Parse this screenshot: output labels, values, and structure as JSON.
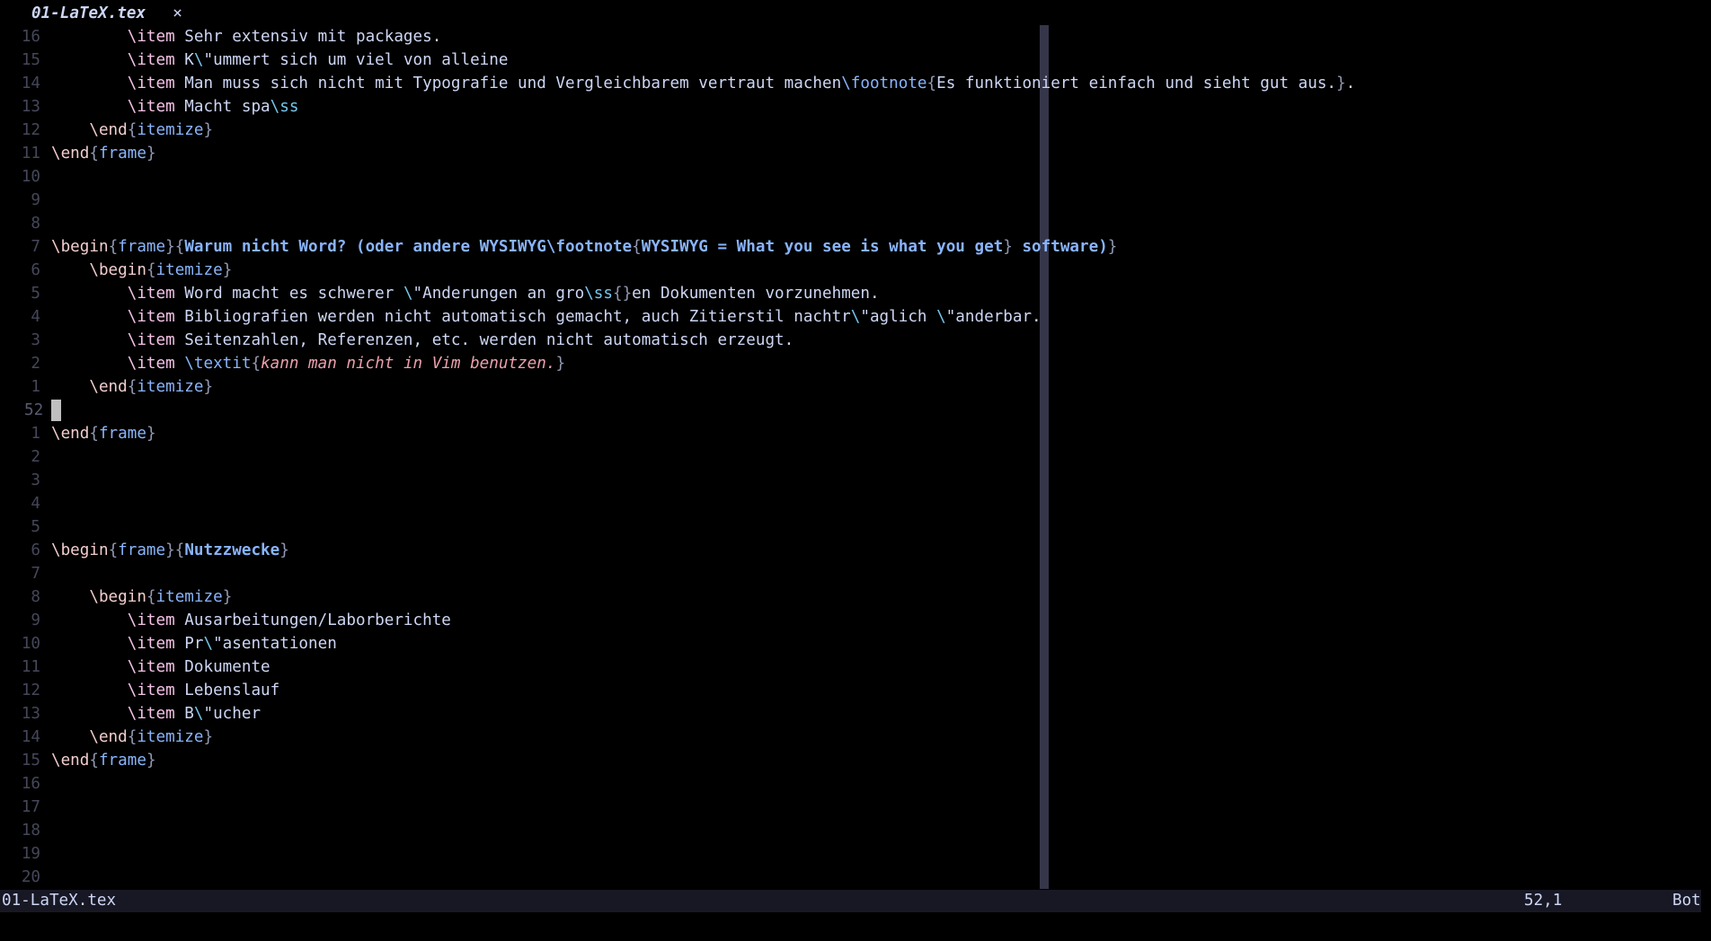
{
  "tab": {
    "title": "01-LaTeX.tex",
    "close_icon": "×"
  },
  "editor": {
    "colorcolumn": 100,
    "lines": [
      {
        "num": "16",
        "segs": [
          {
            "c": "ind",
            "t": "        "
          },
          {
            "c": "cmd",
            "t": "\\item"
          },
          {
            "c": "txt",
            "t": " Sehr extensiv mit packages."
          }
        ]
      },
      {
        "num": "15",
        "segs": [
          {
            "c": "ind",
            "t": "        "
          },
          {
            "c": "cmd",
            "t": "\\item"
          },
          {
            "c": "txt",
            "t": " K"
          },
          {
            "c": "esc",
            "t": "\\"
          },
          {
            "c": "txt",
            "t": "\"ummert sich um viel von alleine"
          }
        ]
      },
      {
        "num": "14",
        "segs": [
          {
            "c": "ind",
            "t": "        "
          },
          {
            "c": "cmd",
            "t": "\\item"
          },
          {
            "c": "txt",
            "t": " Man muss sich nicht mit Typografie und Vergleichbarem vertraut machen"
          },
          {
            "c": "fn",
            "t": "\\footnote"
          },
          {
            "c": "brace",
            "t": "{"
          },
          {
            "c": "txt",
            "t": "Es funktioniert einfach und sieht gut aus."
          },
          {
            "c": "brace",
            "t": "}"
          },
          {
            "c": "txt",
            "t": "."
          }
        ]
      },
      {
        "num": "13",
        "segs": [
          {
            "c": "ind",
            "t": "        "
          },
          {
            "c": "cmd",
            "t": "\\item"
          },
          {
            "c": "txt",
            "t": " Macht spa"
          },
          {
            "c": "esc",
            "t": "\\ss"
          }
        ]
      },
      {
        "num": "12",
        "segs": [
          {
            "c": "ind",
            "t": "    "
          },
          {
            "c": "cmdb",
            "t": "\\end"
          },
          {
            "c": "brace",
            "t": "{"
          },
          {
            "c": "env",
            "t": "itemize"
          },
          {
            "c": "brace",
            "t": "}"
          }
        ]
      },
      {
        "num": "11",
        "segs": [
          {
            "c": "cmdb",
            "t": "\\end"
          },
          {
            "c": "brace",
            "t": "{"
          },
          {
            "c": "env",
            "t": "frame"
          },
          {
            "c": "brace",
            "t": "}"
          }
        ]
      },
      {
        "num": "10",
        "segs": []
      },
      {
        "num": "9",
        "segs": []
      },
      {
        "num": "8",
        "segs": []
      },
      {
        "num": "7",
        "segs": [
          {
            "c": "cmdb",
            "t": "\\begin"
          },
          {
            "c": "brace",
            "t": "{"
          },
          {
            "c": "env",
            "t": "frame"
          },
          {
            "c": "brace",
            "t": "}{"
          },
          {
            "c": "title",
            "t": "Warum nicht Word? (oder andere WYSIWYG\\footnote"
          },
          {
            "c": "brace",
            "t": "{"
          },
          {
            "c": "title",
            "t": "WYSIWYG = What you see is what you get"
          },
          {
            "c": "brace",
            "t": "}"
          },
          {
            "c": "title",
            "t": " software)"
          },
          {
            "c": "brace",
            "t": "}"
          }
        ]
      },
      {
        "num": "6",
        "segs": [
          {
            "c": "ind",
            "t": "    "
          },
          {
            "c": "cmdb",
            "t": "\\begin"
          },
          {
            "c": "brace",
            "t": "{"
          },
          {
            "c": "env",
            "t": "itemize"
          },
          {
            "c": "brace",
            "t": "}"
          }
        ]
      },
      {
        "num": "5",
        "segs": [
          {
            "c": "ind",
            "t": "        "
          },
          {
            "c": "cmd",
            "t": "\\item"
          },
          {
            "c": "txt",
            "t": " Word macht es schwerer "
          },
          {
            "c": "esc",
            "t": "\\"
          },
          {
            "c": "txt",
            "t": "\"Anderungen an gro"
          },
          {
            "c": "esc",
            "t": "\\ss"
          },
          {
            "c": "brace",
            "t": "{}"
          },
          {
            "c": "txt",
            "t": "en Dokumenten vorzunehmen."
          }
        ]
      },
      {
        "num": "4",
        "segs": [
          {
            "c": "ind",
            "t": "        "
          },
          {
            "c": "cmd",
            "t": "\\item"
          },
          {
            "c": "txt",
            "t": " Bibliografien werden nicht automatisch gemacht, auch Zitierstil nachtr"
          },
          {
            "c": "esc",
            "t": "\\"
          },
          {
            "c": "txt",
            "t": "\"aglich "
          },
          {
            "c": "esc",
            "t": "\\"
          },
          {
            "c": "txt",
            "t": "\"anderbar."
          }
        ]
      },
      {
        "num": "3",
        "segs": [
          {
            "c": "ind",
            "t": "        "
          },
          {
            "c": "cmd",
            "t": "\\item"
          },
          {
            "c": "txt",
            "t": " Seitenzahlen, Referenzen, etc. werden nicht automatisch erzeugt."
          }
        ]
      },
      {
        "num": "2",
        "segs": [
          {
            "c": "ind",
            "t": "        "
          },
          {
            "c": "cmd",
            "t": "\\item"
          },
          {
            "c": "txt",
            "t": " "
          },
          {
            "c": "fn",
            "t": "\\textit"
          },
          {
            "c": "brace",
            "t": "{"
          },
          {
            "c": "it",
            "t": "kann man nicht in Vim benutzen."
          },
          {
            "c": "brace",
            "t": "}"
          }
        ]
      },
      {
        "num": "1",
        "segs": [
          {
            "c": "ind",
            "t": "    "
          },
          {
            "c": "cmdb",
            "t": "\\end"
          },
          {
            "c": "brace",
            "t": "{"
          },
          {
            "c": "env",
            "t": "itemize"
          },
          {
            "c": "brace",
            "t": "}"
          }
        ]
      },
      {
        "num": "52",
        "current": true,
        "segs": []
      },
      {
        "num": "1",
        "segs": [
          {
            "c": "cmdb",
            "t": "\\end"
          },
          {
            "c": "brace",
            "t": "{"
          },
          {
            "c": "env",
            "t": "frame"
          },
          {
            "c": "brace",
            "t": "}"
          }
        ]
      },
      {
        "num": "2",
        "segs": []
      },
      {
        "num": "3",
        "segs": []
      },
      {
        "num": "4",
        "segs": []
      },
      {
        "num": "5",
        "segs": []
      },
      {
        "num": "6",
        "segs": [
          {
            "c": "cmdb",
            "t": "\\begin"
          },
          {
            "c": "brace",
            "t": "{"
          },
          {
            "c": "env",
            "t": "frame"
          },
          {
            "c": "brace",
            "t": "}{"
          },
          {
            "c": "title",
            "t": "Nutzzwecke"
          },
          {
            "c": "brace",
            "t": "}"
          }
        ]
      },
      {
        "num": "7",
        "segs": []
      },
      {
        "num": "8",
        "segs": [
          {
            "c": "ind",
            "t": "    "
          },
          {
            "c": "cmdb",
            "t": "\\begin"
          },
          {
            "c": "brace",
            "t": "{"
          },
          {
            "c": "env",
            "t": "itemize"
          },
          {
            "c": "brace",
            "t": "}"
          }
        ]
      },
      {
        "num": "9",
        "segs": [
          {
            "c": "ind",
            "t": "        "
          },
          {
            "c": "cmd",
            "t": "\\item"
          },
          {
            "c": "txt",
            "t": " Ausarbeitungen/Laborberichte"
          }
        ]
      },
      {
        "num": "10",
        "segs": [
          {
            "c": "ind",
            "t": "        "
          },
          {
            "c": "cmd",
            "t": "\\item"
          },
          {
            "c": "txt",
            "t": " Pr"
          },
          {
            "c": "esc",
            "t": "\\"
          },
          {
            "c": "txt",
            "t": "\"asentationen"
          }
        ]
      },
      {
        "num": "11",
        "segs": [
          {
            "c": "ind",
            "t": "        "
          },
          {
            "c": "cmd",
            "t": "\\item"
          },
          {
            "c": "txt",
            "t": " Dokumente"
          }
        ]
      },
      {
        "num": "12",
        "segs": [
          {
            "c": "ind",
            "t": "        "
          },
          {
            "c": "cmd",
            "t": "\\item"
          },
          {
            "c": "txt",
            "t": " Lebenslauf"
          }
        ]
      },
      {
        "num": "13",
        "segs": [
          {
            "c": "ind",
            "t": "        "
          },
          {
            "c": "cmd",
            "t": "\\item"
          },
          {
            "c": "txt",
            "t": " B"
          },
          {
            "c": "esc",
            "t": "\\"
          },
          {
            "c": "txt",
            "t": "\"ucher"
          }
        ]
      },
      {
        "num": "14",
        "segs": [
          {
            "c": "ind",
            "t": "    "
          },
          {
            "c": "cmdb",
            "t": "\\end"
          },
          {
            "c": "brace",
            "t": "{"
          },
          {
            "c": "env",
            "t": "itemize"
          },
          {
            "c": "brace",
            "t": "}"
          }
        ]
      },
      {
        "num": "15",
        "segs": [
          {
            "c": "cmdb",
            "t": "\\end"
          },
          {
            "c": "brace",
            "t": "{"
          },
          {
            "c": "env",
            "t": "frame"
          },
          {
            "c": "brace",
            "t": "}"
          }
        ]
      },
      {
        "num": "16",
        "segs": []
      },
      {
        "num": "17",
        "segs": []
      },
      {
        "num": "18",
        "segs": []
      },
      {
        "num": "19",
        "segs": []
      },
      {
        "num": "20",
        "segs": []
      }
    ]
  },
  "statusline": {
    "filename": "01-LaTeX.tex",
    "position": "52,1",
    "scroll": "Bot"
  },
  "colors": {
    "background": "#000000",
    "text": "#cdd6f4",
    "command": "#f5c2e7",
    "environment": "#89b4fa",
    "brace": "#9399b2",
    "italic": "#eba0ac",
    "line_number": "#45475a",
    "colorcolumn": "#36364a",
    "statusline_bg": "#181825"
  }
}
